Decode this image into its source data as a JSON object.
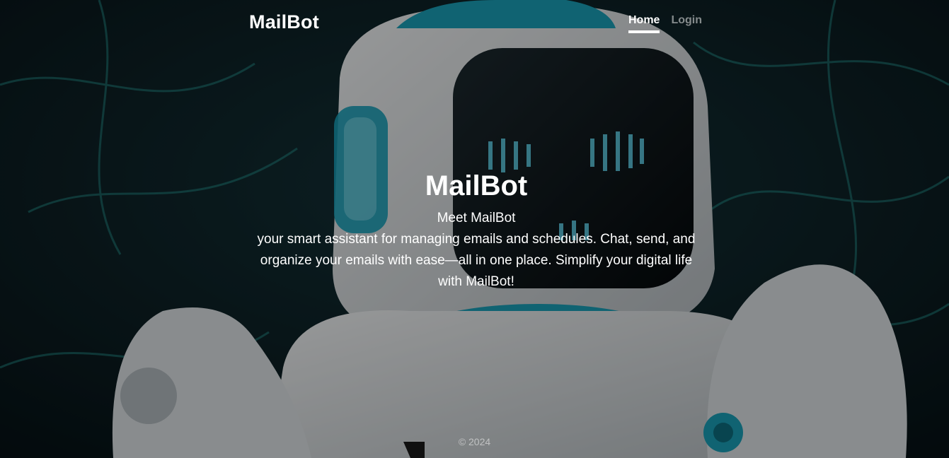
{
  "nav": {
    "brand": "MailBot",
    "links": [
      {
        "label": "Home",
        "active": true
      },
      {
        "label": "Login",
        "active": false
      }
    ]
  },
  "hero": {
    "title": "MailBot",
    "subtitle": "Meet MailBot",
    "description": "your smart assistant for managing emails and schedules. Chat, send, and organize your emails with ease—all in one place. Simplify your digital life with MailBot!"
  },
  "footer": {
    "copyright": "© 2024"
  },
  "colors": {
    "accent_teal": "#1aa0b8",
    "robot_white": "#e8ecef",
    "background_dark": "#0b1418"
  }
}
